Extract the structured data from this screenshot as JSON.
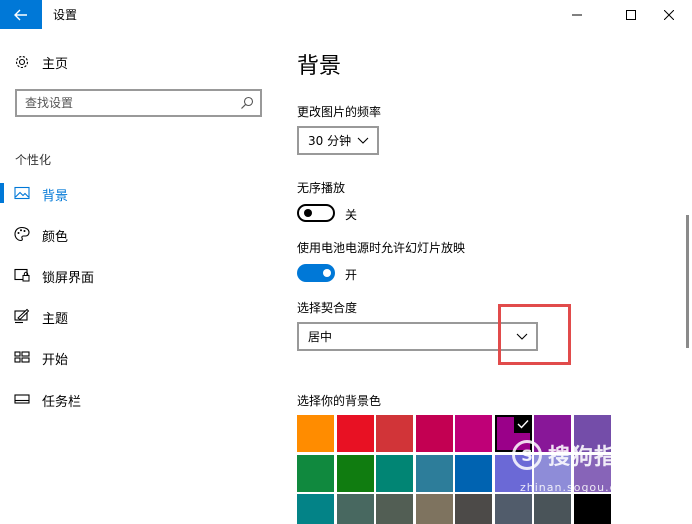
{
  "window": {
    "title": "设置"
  },
  "sidebar": {
    "home_label": "主页",
    "search_placeholder": "查找设置",
    "section_title": "个性化",
    "items": [
      {
        "label": "背景",
        "icon": "image-icon",
        "active": true
      },
      {
        "label": "颜色",
        "icon": "palette-icon",
        "active": false
      },
      {
        "label": "锁屏界面",
        "icon": "lock-screen-icon",
        "active": false
      },
      {
        "label": "主题",
        "icon": "theme-brush-icon",
        "active": false
      },
      {
        "label": "开始",
        "icon": "start-menu-icon",
        "active": false
      },
      {
        "label": "任务栏",
        "icon": "taskbar-icon",
        "active": false
      }
    ]
  },
  "main": {
    "title": "背景",
    "change_freq_label": "更改图片的频率",
    "change_freq_value": "30 分钟",
    "shuffle_label": "无序播放",
    "shuffle_state": "关",
    "battery_label": "使用电池电源时允许幻灯片放映",
    "battery_state": "开",
    "fit_label": "选择契合度",
    "fit_value": "居中",
    "bg_color_label": "选择你的背景色",
    "colors": [
      [
        "#ff8c00",
        "#e81123",
        "#d13438",
        "#c30052",
        "#bf0077",
        "#9a0089",
        "#881798",
        "#744da9"
      ],
      [
        "#10893e",
        "#107c10",
        "#018574",
        "#2d7d9a",
        "#0063b1",
        "#6b69d6",
        "#8e8cd8",
        "#8764b8"
      ],
      [
        "#038387",
        "#486860",
        "#525e54",
        "#7e735f",
        "#4c4a48",
        "#515c6b",
        "#4a5459",
        "#000000"
      ]
    ],
    "selected_color_index": 5
  },
  "watermark": {
    "logo_letter": "S",
    "text": "搜狗指南",
    "url": "zhinan.sogou.com"
  },
  "theme": {
    "accent": "#0078d7",
    "highlight_box": "#e14b4b"
  }
}
